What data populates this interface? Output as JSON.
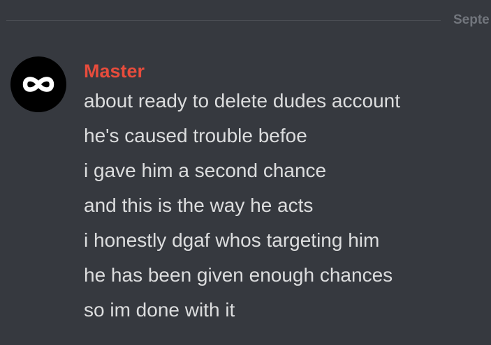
{
  "date_divider": {
    "label": "Septe"
  },
  "message_group": {
    "avatar": {
      "icon": "infinity-icon",
      "background": "#000000"
    },
    "author": {
      "name": "Master",
      "color": "#e74c3c"
    },
    "messages": [
      "about ready to delete dudes account",
      "he's caused trouble befoe",
      "i gave him a second chance",
      "and this is the way he acts",
      "i honestly dgaf whos targeting him",
      "he has been given enough chances",
      "so im done with it"
    ]
  }
}
